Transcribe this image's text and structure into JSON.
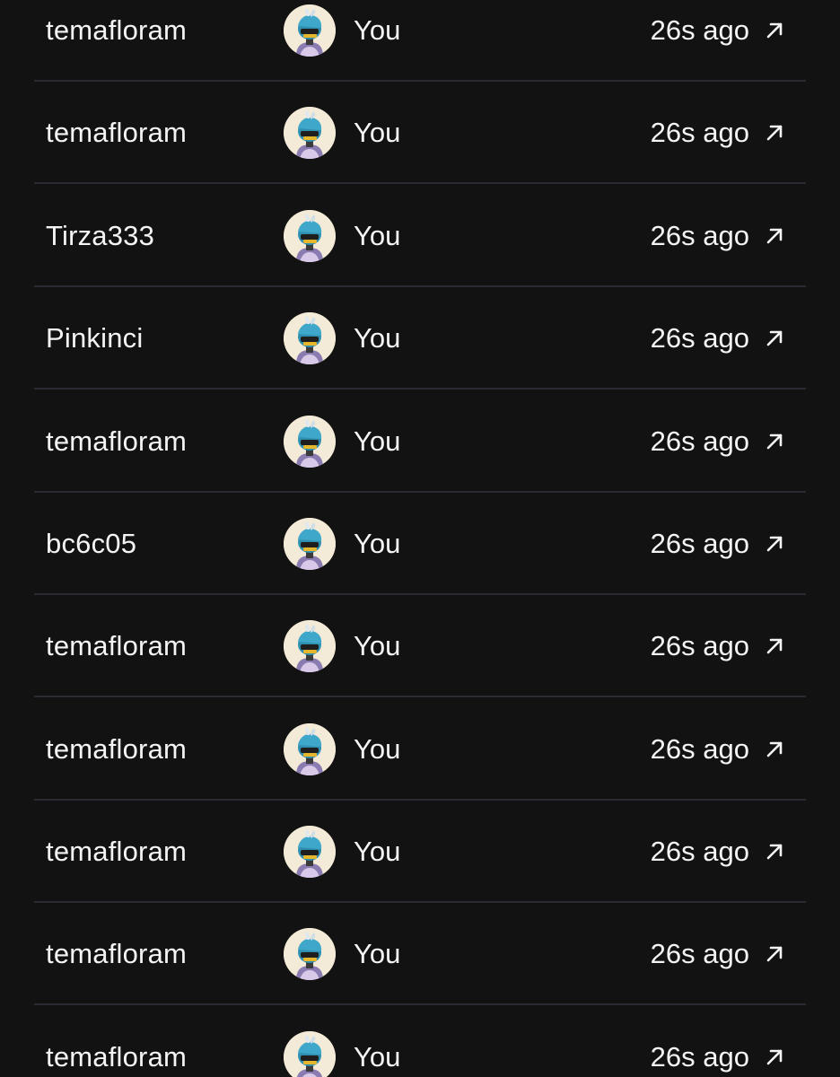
{
  "colors": {
    "background": "#121213",
    "text": "#f4f4f5",
    "divider": "#2a2a33",
    "avatar_bg": "#f3ead7"
  },
  "rows": [
    {
      "from": "temafloram",
      "to": "You",
      "time": "26s ago",
      "avatar_icon": "nft-avatar-icon",
      "link_icon": "arrow-up-right-icon"
    },
    {
      "from": "temafloram",
      "to": "You",
      "time": "26s ago",
      "avatar_icon": "nft-avatar-icon",
      "link_icon": "arrow-up-right-icon"
    },
    {
      "from": "Tirza333",
      "to": "You",
      "time": "26s ago",
      "avatar_icon": "nft-avatar-icon",
      "link_icon": "arrow-up-right-icon"
    },
    {
      "from": "Pinkinci",
      "to": "You",
      "time": "26s ago",
      "avatar_icon": "nft-avatar-icon",
      "link_icon": "arrow-up-right-icon"
    },
    {
      "from": "temafloram",
      "to": "You",
      "time": "26s ago",
      "avatar_icon": "nft-avatar-icon",
      "link_icon": "arrow-up-right-icon"
    },
    {
      "from": "bc6c05",
      "to": "You",
      "time": "26s ago",
      "avatar_icon": "nft-avatar-icon",
      "link_icon": "arrow-up-right-icon"
    },
    {
      "from": "temafloram",
      "to": "You",
      "time": "26s ago",
      "avatar_icon": "nft-avatar-icon",
      "link_icon": "arrow-up-right-icon"
    },
    {
      "from": "temafloram",
      "to": "You",
      "time": "26s ago",
      "avatar_icon": "nft-avatar-icon",
      "link_icon": "arrow-up-right-icon"
    },
    {
      "from": "temafloram",
      "to": "You",
      "time": "26s ago",
      "avatar_icon": "nft-avatar-icon",
      "link_icon": "arrow-up-right-icon"
    },
    {
      "from": "temafloram",
      "to": "You",
      "time": "26s ago",
      "avatar_icon": "nft-avatar-icon",
      "link_icon": "arrow-up-right-icon"
    },
    {
      "from": "temafloram",
      "to": "You",
      "time": "26s ago",
      "avatar_icon": "nft-avatar-icon",
      "link_icon": "arrow-up-right-icon"
    }
  ]
}
